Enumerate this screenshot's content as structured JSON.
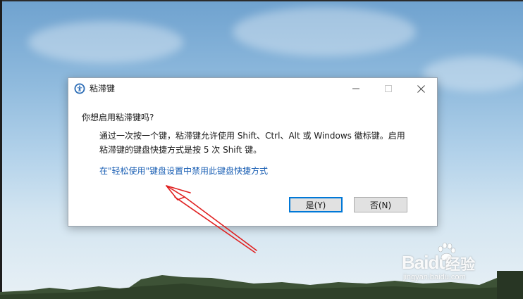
{
  "dialog": {
    "title": "粘滞键",
    "question": "你想启用粘滞键吗?",
    "description_line1": "通过一次按一个键，粘滞键允许使用 Shift、Ctrl、Alt 或 Windows 徽标键。启用",
    "description_line2": "粘滞键的键盘快捷方式是按 5 次 Shift 键。",
    "settings_link": "在\"轻松使用\"键盘设置中禁用此键盘快捷方式",
    "yes_button": "是(Y)",
    "no_button": "否(N)"
  },
  "window_controls": [
    "minimize-icon",
    "maximize-icon",
    "close-icon"
  ],
  "icons": {
    "app": "ease-of-access-icon"
  },
  "watermark": {
    "brand": "Bai",
    "brand_suffix": "du",
    "product": "经验",
    "url": "jingyan.baidu.com"
  },
  "colors": {
    "link": "#1a5fb4",
    "default_button_border": "#0078d7",
    "annotation_arrow": "#e02020"
  }
}
